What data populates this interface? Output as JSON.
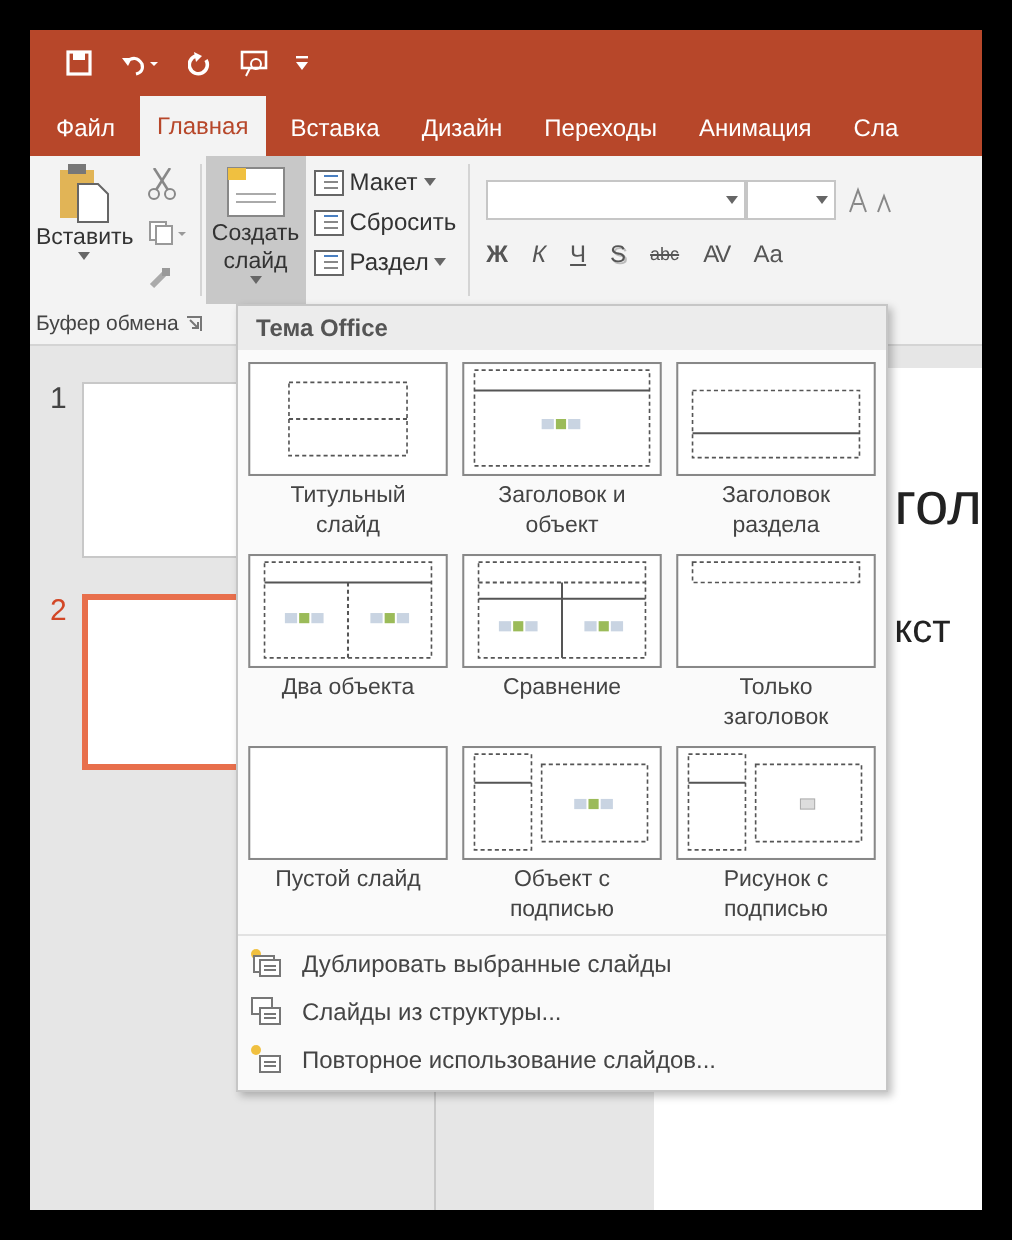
{
  "tabs": [
    {
      "label": "Файл",
      "selected": false
    },
    {
      "label": "Главная",
      "selected": true
    },
    {
      "label": "Вставка",
      "selected": false
    },
    {
      "label": "Дизайн",
      "selected": false
    },
    {
      "label": "Переходы",
      "selected": false
    },
    {
      "label": "Анимация",
      "selected": false
    },
    {
      "label": "Сла",
      "selected": false
    }
  ],
  "clipboard": {
    "paste": "Вставить",
    "group_label": "Буфер обмена"
  },
  "new_slide": {
    "label": "Создать слайд",
    "pressed": true
  },
  "slide_commands": [
    {
      "label": "Макет",
      "dropdown": true
    },
    {
      "label": "Сбросить",
      "dropdown": false
    },
    {
      "label": "Раздел",
      "dropdown": true
    }
  ],
  "font_buttons": [
    {
      "label": "Ж",
      "kind": "bold"
    },
    {
      "label": "К",
      "kind": "italic"
    },
    {
      "label": "Ч",
      "kind": "underline"
    },
    {
      "label": "S",
      "kind": "shadow"
    },
    {
      "label": "abc",
      "kind": "strike"
    },
    {
      "label": "AV",
      "kind": "spacing"
    },
    {
      "label": "Aa",
      "kind": "case"
    }
  ],
  "slide_thumbnails": [
    {
      "number": "1",
      "selected": false
    },
    {
      "number": "2",
      "selected": true
    }
  ],
  "slide": {
    "title_fragment": "гол",
    "subtitle_fragment": "кст"
  },
  "layout_menu": {
    "header": "Тема Office",
    "layouts": [
      {
        "label": "Титульный слайд",
        "kind": "title"
      },
      {
        "label": "Заголовок и объект",
        "kind": "title_content"
      },
      {
        "label": "Заголовок раздела",
        "kind": "section"
      },
      {
        "label": "Два объекта",
        "kind": "two_content"
      },
      {
        "label": "Сравнение",
        "kind": "comparison"
      },
      {
        "label": "Только заголовок",
        "kind": "title_only"
      },
      {
        "label": "Пустой слайд",
        "kind": "blank"
      },
      {
        "label": "Объект с подписью",
        "kind": "content_caption"
      },
      {
        "label": "Рисунок с подписью",
        "kind": "picture_caption"
      }
    ],
    "commands": [
      {
        "label": "Дублировать выбранные слайды",
        "kind": "duplicate"
      },
      {
        "label": "Слайды из структуры...",
        "kind": "outline"
      },
      {
        "label": "Повторное использование слайдов...",
        "kind": "reuse"
      }
    ]
  }
}
